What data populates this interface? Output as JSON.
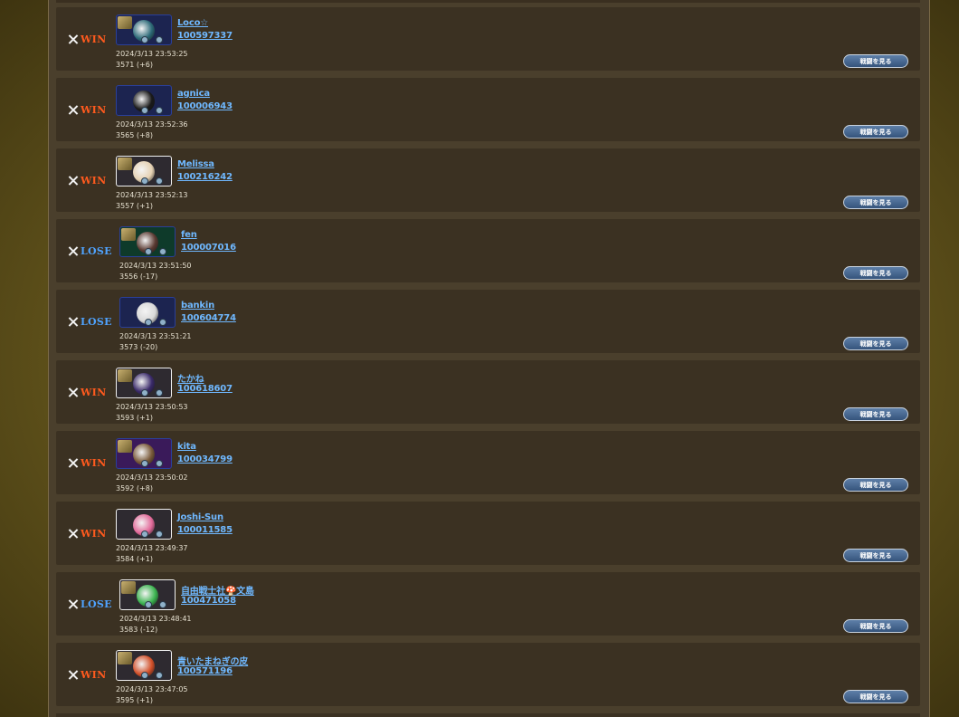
{
  "watch_button_label": "戦闘を見る",
  "result_colors": {
    "win": "#ff5a1e",
    "lose": "#4fa3ff"
  },
  "matches": [
    {
      "result": "WIN",
      "name": "Loco☆",
      "id": "100597337",
      "datetime": "2024/3/13 23:53:25",
      "rating": "3571 (+6)",
      "icon_name": "team-icon",
      "avatar_color": "#2d6a78",
      "frame_color": "#1c2450"
    },
    {
      "result": "WIN",
      "name": "agnica",
      "id": "100006943",
      "datetime": "2024/3/13 23:52:36",
      "rating": "3565 (+8)",
      "icon_name": "team-icon",
      "avatar_color": "#1a1a1a",
      "frame_color": "#1c2450"
    },
    {
      "result": "WIN",
      "name": "Melissa",
      "id": "100216242",
      "datetime": "2024/3/13 23:52:13",
      "rating": "3557 (+1)",
      "icon_name": "team-icon",
      "avatar_color": "#e6d2b4",
      "frame_color": "#ffffff"
    },
    {
      "result": "LOSE",
      "name": "fen",
      "id": "100007016",
      "datetime": "2024/3/13 23:51:50",
      "rating": "3556 (-17)",
      "icon_name": "team-icon",
      "avatar_color": "#5a3a32",
      "frame_color": "#0e3a2a"
    },
    {
      "result": "LOSE",
      "name": "bankin",
      "id": "100604774",
      "datetime": "2024/3/13 23:51:21",
      "rating": "3573 (-20)",
      "icon_name": "team-icon",
      "avatar_color": "#d8d8d8",
      "frame_color": "#1c2450"
    },
    {
      "result": "WIN",
      "name": "たかね",
      "id": "100618607",
      "datetime": "2024/3/13 23:50:53",
      "rating": "3593 (+1)",
      "icon_name": "team-icon",
      "avatar_color": "#3a2a6a",
      "frame_color": "#ffffff"
    },
    {
      "result": "WIN",
      "name": "kita",
      "id": "100034799",
      "datetime": "2024/3/13 23:50:02",
      "rating": "3592 (+8)",
      "icon_name": "team-icon",
      "avatar_color": "#7a5a3a",
      "frame_color": "#3a1a5a"
    },
    {
      "result": "WIN",
      "name": "Joshi-Sun",
      "id": "100011585",
      "datetime": "2024/3/13 23:49:37",
      "rating": "3584 (+1)",
      "icon_name": "team-icon",
      "avatar_color": "#e26a9a",
      "frame_color": "#ffffff"
    },
    {
      "result": "LOSE",
      "name": "自由戦士社🍄文島",
      "id": "100471058",
      "datetime": "2024/3/13 23:48:41",
      "rating": "3583 (-12)",
      "icon_name": "team-icon",
      "avatar_color": "#3cb450",
      "frame_color": "#ffffff"
    },
    {
      "result": "WIN",
      "name": "青いたまねぎの皮",
      "id": "100571196",
      "datetime": "2024/3/13 23:47:05",
      "rating": "3595 (+1)",
      "icon_name": "team-icon",
      "avatar_color": "#d2502a",
      "frame_color": "#ffffff"
    }
  ]
}
